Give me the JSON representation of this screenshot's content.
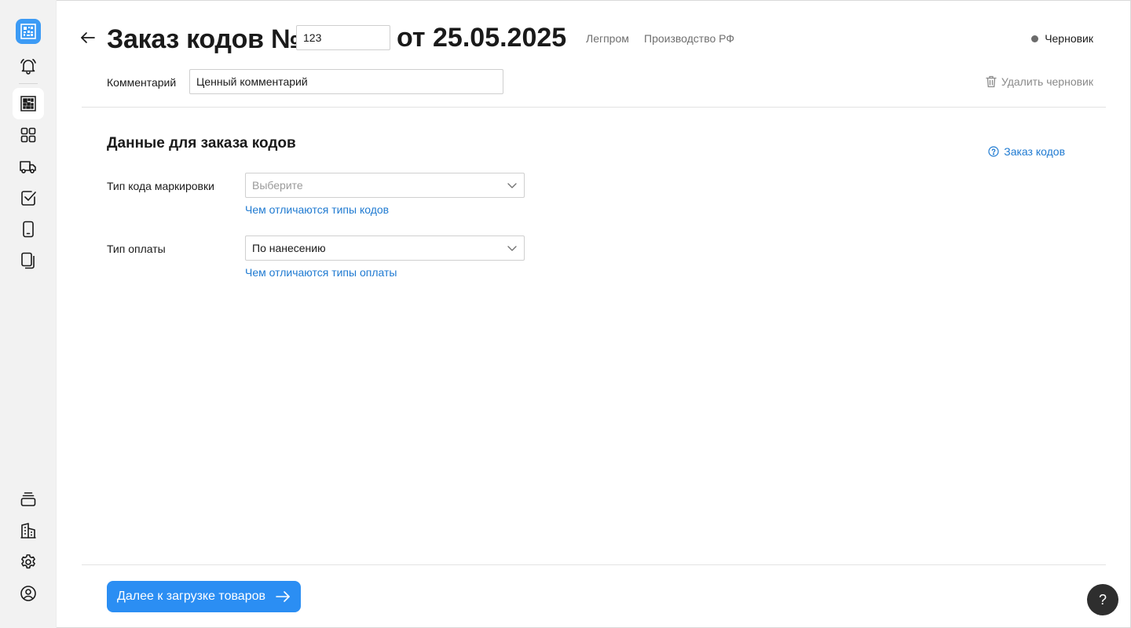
{
  "header": {
    "title_prefix": "Заказ кодов №",
    "order_number": "123",
    "title_date": "от 25.05.2025",
    "tags": [
      "Легпром",
      "Производство РФ"
    ],
    "status": "Черновик",
    "status_color": "#6b6b6b"
  },
  "comment": {
    "label": "Комментарий",
    "value": "Ценный комментарий"
  },
  "delete_draft_label": "Удалить черновик",
  "section": {
    "title": "Данные для заказа кодов",
    "help_link": "Заказ кодов"
  },
  "fields": {
    "code_type": {
      "label": "Тип кода маркировки",
      "placeholder": "Выберите",
      "link": "Чем отличаются типы кодов"
    },
    "payment_type": {
      "label": "Тип оплаты",
      "value": "По нанесению",
      "link": "Чем отличаются типы оплаты"
    }
  },
  "footer": {
    "next_button": "Далее к загрузке товаров",
    "help_fab": "?"
  },
  "colors": {
    "accent": "#2b8ef3",
    "link": "#1f7ad1",
    "logo": "#3c9bf5"
  },
  "sidebar": {
    "top_icons": [
      "qr-logo-icon",
      "bell-icon",
      "datamatrix-icon",
      "grid-icon",
      "truck-icon",
      "checkbox-icon",
      "phone-icon",
      "documents-icon"
    ],
    "bottom_icons": [
      "stack-icon",
      "buildings-icon",
      "gear-icon",
      "user-icon"
    ]
  }
}
